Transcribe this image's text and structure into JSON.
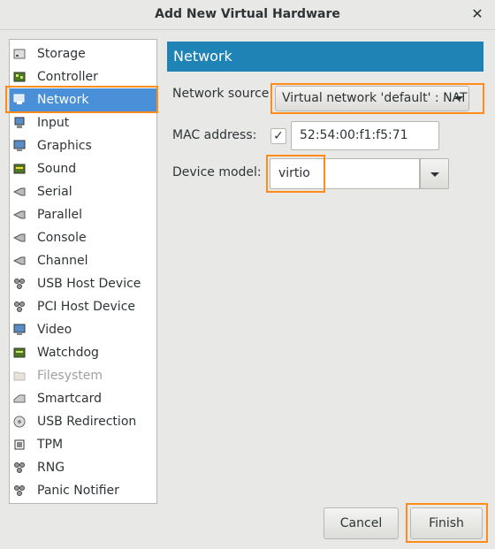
{
  "window": {
    "title": "Add New Virtual Hardware",
    "close_glyph": "✕"
  },
  "sidebar": {
    "items": [
      {
        "label": "Storage",
        "icon": "storage-icon"
      },
      {
        "label": "Controller",
        "icon": "controller-icon"
      },
      {
        "label": "Network",
        "icon": "network-icon",
        "selected": true
      },
      {
        "label": "Input",
        "icon": "input-icon"
      },
      {
        "label": "Graphics",
        "icon": "graphics-icon"
      },
      {
        "label": "Sound",
        "icon": "sound-icon"
      },
      {
        "label": "Serial",
        "icon": "serial-icon"
      },
      {
        "label": "Parallel",
        "icon": "parallel-icon"
      },
      {
        "label": "Console",
        "icon": "console-icon"
      },
      {
        "label": "Channel",
        "icon": "channel-icon"
      },
      {
        "label": "USB Host Device",
        "icon": "usb-host-icon"
      },
      {
        "label": "PCI Host Device",
        "icon": "pci-host-icon"
      },
      {
        "label": "Video",
        "icon": "video-icon"
      },
      {
        "label": "Watchdog",
        "icon": "watchdog-icon"
      },
      {
        "label": "Filesystem",
        "icon": "filesystem-icon",
        "disabled": true
      },
      {
        "label": "Smartcard",
        "icon": "smartcard-icon"
      },
      {
        "label": "USB Redirection",
        "icon": "usb-redirection-icon"
      },
      {
        "label": "TPM",
        "icon": "tpm-icon"
      },
      {
        "label": "RNG",
        "icon": "rng-icon"
      },
      {
        "label": "Panic Notifier",
        "icon": "panic-notifier-icon"
      }
    ]
  },
  "main": {
    "header": "Network",
    "network_source_label": "Network source:",
    "network_source_value": "Virtual network 'default' : NAT",
    "mac_label": "MAC address:",
    "mac_checked": true,
    "mac_value": "52:54:00:f1:f5:71",
    "device_model_label": "Device model:",
    "device_model_value": "virtio"
  },
  "buttons": {
    "cancel": "Cancel",
    "finish": "Finish"
  },
  "colors": {
    "accent": "#1f83b6",
    "selection": "#4a90d9",
    "highlight": "#ff8c1a"
  }
}
